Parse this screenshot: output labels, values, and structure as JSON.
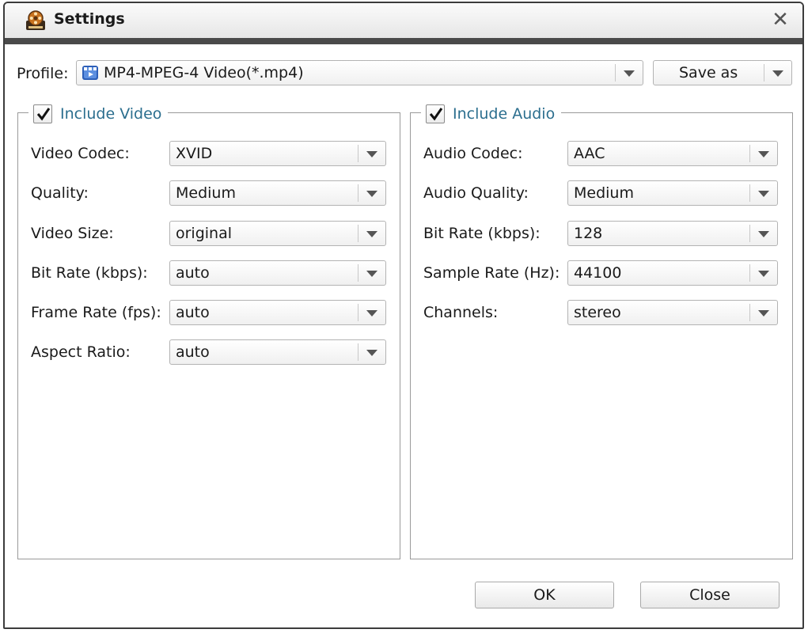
{
  "window": {
    "title": "Settings",
    "app_icon": "film-reel-icon",
    "close_icon": "close-icon",
    "close_glyph": "✕"
  },
  "profile": {
    "label": "Profile:",
    "value": "MP4-MPEG-4 Video(*.mp4)",
    "value_icon": "video-file-icon",
    "save_as_label": "Save as"
  },
  "video": {
    "include_label": "Include Video",
    "include_checked": true,
    "rows": [
      {
        "label": "Video Codec:",
        "value": "XVID"
      },
      {
        "label": "Quality:",
        "value": "Medium"
      },
      {
        "label": "Video Size:",
        "value": "original"
      },
      {
        "label": "Bit Rate (kbps):",
        "value": "auto"
      },
      {
        "label": "Frame Rate (fps):",
        "value": "auto"
      },
      {
        "label": "Aspect Ratio:",
        "value": "auto"
      }
    ]
  },
  "audio": {
    "include_label": "Include Audio",
    "include_checked": true,
    "rows": [
      {
        "label": "Audio Codec:",
        "value": "AAC"
      },
      {
        "label": "Audio Quality:",
        "value": "Medium"
      },
      {
        "label": "Bit Rate (kbps):",
        "value": "128"
      },
      {
        "label": "Sample Rate (Hz):",
        "value": "44100"
      },
      {
        "label": "Channels:",
        "value": "stereo"
      }
    ]
  },
  "footer": {
    "ok_label": "OK",
    "close_label": "Close"
  },
  "colors": {
    "accent_text": "#2b6e8e",
    "title_bar_bottom": "#4a4a4a"
  }
}
